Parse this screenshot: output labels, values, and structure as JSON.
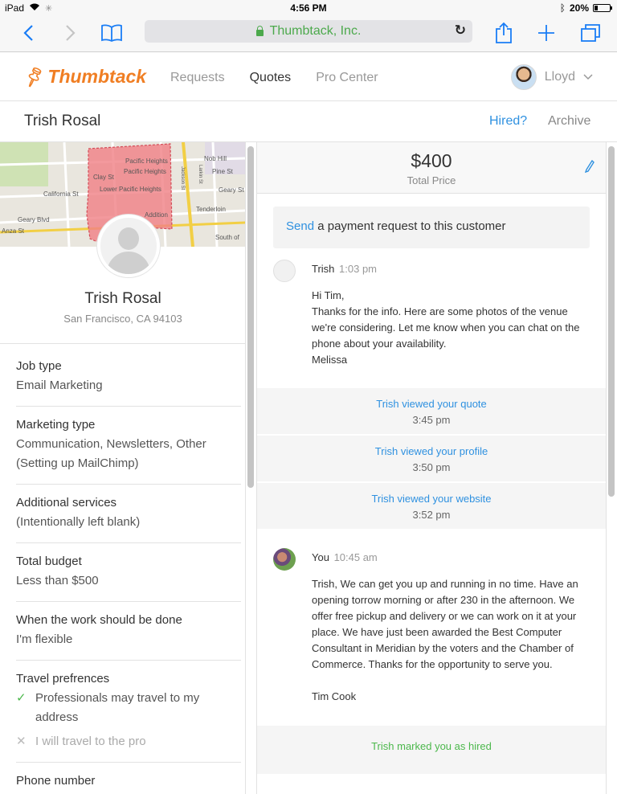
{
  "status_bar": {
    "device": "iPad",
    "time": "4:56 PM",
    "battery": "20%",
    "battery_level": 0.2
  },
  "browser": {
    "url_title": "Thumbtack, Inc."
  },
  "header": {
    "logo": "Thumbtack",
    "nav": [
      "Requests",
      "Quotes",
      "Pro Center"
    ],
    "active_nav": "Quotes",
    "user": "Lloyd"
  },
  "subheader": {
    "customer_name": "Trish Rosal",
    "hired_link": "Hired?",
    "archive_link": "Archive"
  },
  "map": {
    "labels": [
      "Pacific Heights",
      "Pacific Heights",
      "Lower Pacific Heights",
      "Nob Hill",
      "Pine St",
      "Clay St",
      "California St",
      "Geary St",
      "Tenderloin",
      "Geary Blvd",
      "Anza St",
      "Addition",
      "Jackson St",
      "Larkin St",
      "South of"
    ]
  },
  "profile": {
    "name": "Trish Rosal",
    "location": "San Francisco, CA 94103"
  },
  "details": [
    {
      "label": "Job type",
      "value": "Email Marketing"
    },
    {
      "label": "Marketing type",
      "value": "Communication, Newsletters, Other (Setting up MailChimp)"
    },
    {
      "label": "Additional services",
      "value": "(Intentionally left blank)"
    },
    {
      "label": "Total budget",
      "value": "Less than $500"
    },
    {
      "label": "When the work should be done",
      "value": "I'm flexible"
    }
  ],
  "travel": {
    "label": "Travel prefrences",
    "yes_option": "Professionals may travel to my address",
    "no_option": "I will travel to the pro"
  },
  "next_label": "Phone number",
  "quote": {
    "price": "$400",
    "price_label": "Total Price"
  },
  "payment": {
    "link": "Send",
    "text": " a payment request to this customer"
  },
  "messages": [
    {
      "sender": "Trish",
      "time": "1:03 pm",
      "body": "Hi Tim,\nThanks for the info. Here are some photos of the venue we're considering. Let me know when you can chat on the phone about your availability.\nMelissa"
    },
    {
      "sender": "You",
      "time": "10:45 am",
      "body": "Trish, We can get you up and running in no time. Have an opening torrow morning or after 230 in the afternoon. We offer free pickup and delivery or we can work on it at your place. We have just been awarded the Best Computer Consultant in Meridian by the voters and the Chamber of Commerce. Thanks for the opportunity to serve you.\n\nTim Cook"
    }
  ],
  "events": [
    {
      "title": "Trish viewed your quote",
      "time": "3:45 pm"
    },
    {
      "title": "Trish viewed your profile",
      "time": "3:50 pm"
    },
    {
      "title": "Trish viewed your website",
      "time": "3:52 pm"
    }
  ],
  "hired_event": {
    "title": "Trish marked you as hired"
  }
}
